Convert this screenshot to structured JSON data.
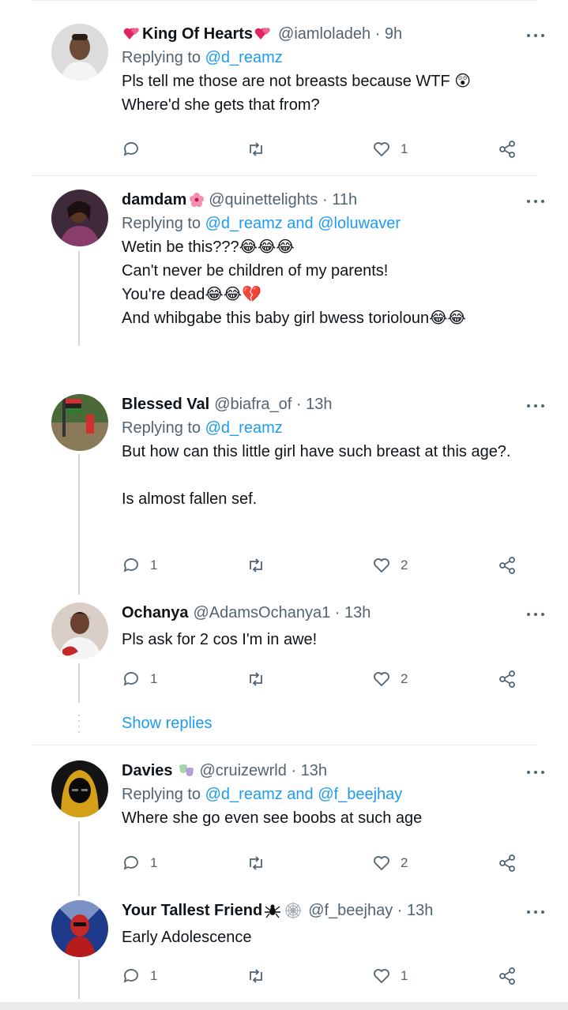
{
  "tweets": [
    {
      "name": "King Of Hearts",
      "handle": "@iamloladeh · 9h",
      "reply_prefix": "Replying to ",
      "reply_to": "@d_reamz",
      "reply_and": "",
      "reply_to2": "",
      "text": "Pls tell me those are not breasts because WTF 😲\nWhere'd she gets that from?",
      "replies": "",
      "retweets": "",
      "likes": "1"
    },
    {
      "name": "damdam",
      "handle": "@quinettelights · 11h",
      "reply_prefix": "Replying to ",
      "reply_to": "@d_reamz",
      "reply_and": " and ",
      "reply_to2": "@loluwaver",
      "text": "Wetin be this???😂😂😂\nCan't never be children of my parents!\nYou're dead😂😂💔\nAnd whibgabe this baby girl bwess torioloun😂😂",
      "replies": "",
      "retweets": "",
      "likes": ""
    },
    {
      "name": "Blessed Val",
      "handle": "@biafra_of · 13h",
      "reply_prefix": "Replying to ",
      "reply_to": "@d_reamz",
      "reply_and": "",
      "reply_to2": "",
      "text": "But how can this little girl have such breast at this age?.\n\nIs almost fallen sef.",
      "replies": "1",
      "retweets": "",
      "likes": "2"
    },
    {
      "name": "Ochanya",
      "handle": "@AdamsOchanya1 · 13h",
      "text": "Pls ask for 2 cos I'm in awe!",
      "replies": "1",
      "retweets": "",
      "likes": "2"
    },
    {
      "name": "Davies",
      "handle": "@cruizewrld · 13h",
      "reply_prefix": "Replying to ",
      "reply_to": "@d_reamz",
      "reply_and": " and ",
      "reply_to2": "@f_beejhay",
      "text": "Where she go even see boobs at such age",
      "replies": "1",
      "retweets": "",
      "likes": "2"
    },
    {
      "name": "Your Tallest Friend",
      "handle": "@f_beejhay · 13h",
      "text": "Early Adolescence",
      "replies": "1",
      "retweets": "",
      "likes": "1"
    }
  ],
  "show_replies": "Show replies",
  "colors": {
    "link": "#1d9bf0",
    "muted": "#536471",
    "thread": "#cfd9de",
    "divider": "#e6ecf0"
  },
  "icons": [
    "reply-icon",
    "retweet-icon",
    "like-icon",
    "share-icon",
    "more-icon"
  ]
}
